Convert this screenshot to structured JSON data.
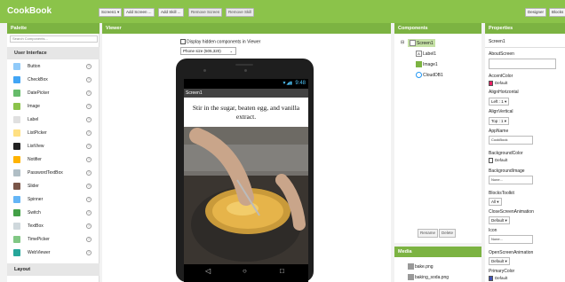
{
  "app": {
    "logo": "CookBook"
  },
  "toolbar": {
    "screen_select": "Screen1 ▾",
    "add_screen": "Add Screen ...",
    "add_skill": "Add Skill ...",
    "remove_screen": "Remove Screen",
    "remove_skill": "Remove Skill",
    "designer": "Designer",
    "blocks": "Blocks"
  },
  "palette": {
    "header": "Palette",
    "search_placeholder": "Search Components...",
    "category": "User Interface",
    "items": [
      {
        "label": "Button",
        "icon": "button-icon"
      },
      {
        "label": "CheckBox",
        "icon": "checkbox-icon"
      },
      {
        "label": "DatePicker",
        "icon": "datepicker-icon"
      },
      {
        "label": "Image",
        "icon": "image-icon"
      },
      {
        "label": "Label",
        "icon": "label-icon"
      },
      {
        "label": "ListPicker",
        "icon": "listpicker-icon"
      },
      {
        "label": "ListView",
        "icon": "listview-icon"
      },
      {
        "label": "Notifier",
        "icon": "notifier-icon"
      },
      {
        "label": "PasswordTextBox",
        "icon": "password-icon"
      },
      {
        "label": "Slider",
        "icon": "slider-icon"
      },
      {
        "label": "Spinner",
        "icon": "spinner-icon"
      },
      {
        "label": "Switch",
        "icon": "switch-icon"
      },
      {
        "label": "TextBox",
        "icon": "textbox-icon"
      },
      {
        "label": "TimePicker",
        "icon": "timepicker-icon"
      },
      {
        "label": "WebViewer",
        "icon": "webviewer-icon"
      }
    ],
    "help": "?",
    "next_category": "Layout"
  },
  "viewer": {
    "header": "Viewer",
    "hidden_check": "Display hidden components in Viewer",
    "phone_size": "Phone size (505,320)",
    "status_time": "9:48",
    "screen_title": "Screen1",
    "label_text": "Stir in the sugar, beaten egg, and vanilla extract."
  },
  "components": {
    "header": "Components",
    "root": "Screen1",
    "children": [
      "Label1",
      "Image1",
      "CloudDB1"
    ],
    "rename": "Rename",
    "delete": "Delete"
  },
  "media": {
    "header": "Media",
    "files": [
      "bake.png",
      "baking_soda.png"
    ]
  },
  "properties": {
    "header": "Properties",
    "component": "Screen1",
    "about_screen": "AboutScreen",
    "accent_color": "AccentColor",
    "accent_value": "Default",
    "align_h": "AlignHorizontal",
    "align_h_value": "Left : 1 ▾",
    "align_v": "AlignVertical",
    "align_v_value": "Top : 1 ▾",
    "app_name": "AppName",
    "app_name_value": "CookBook",
    "bg_color": "BackgroundColor",
    "bg_color_value": "Default",
    "bg_image": "BackgroundImage",
    "bg_image_value": "None...",
    "blocks_toolkit": "BlocksToolkit",
    "blocks_toolkit_value": "All ▾",
    "close_anim": "CloseScreenAnimation",
    "close_anim_value": "Default ▾",
    "icon": "Icon",
    "icon_value": "None...",
    "open_anim": "OpenScreenAnimation",
    "open_anim_value": "Default ▾",
    "primary_color": "PrimaryColor",
    "primary_color_value": "Default"
  },
  "colors": {
    "topbar": "#8bc34a",
    "header": "#7cb342",
    "accent_swatch": "#e91e63",
    "primary_swatch": "#3f51b5"
  }
}
